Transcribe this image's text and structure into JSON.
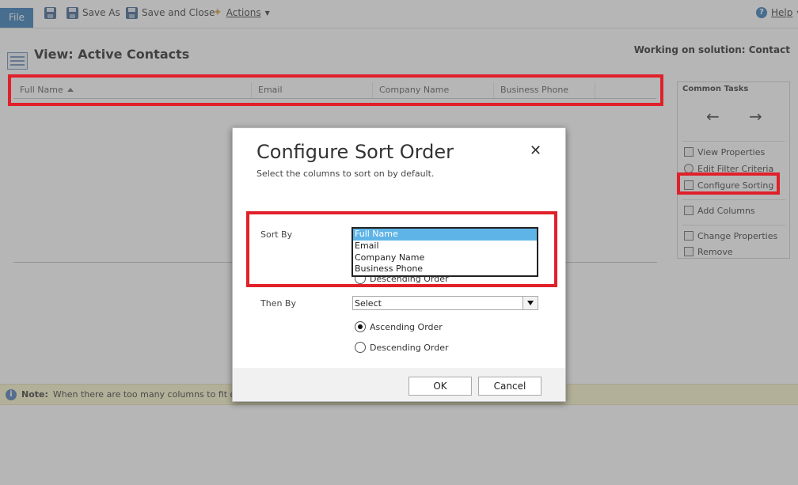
{
  "ribbon": {
    "file": "File",
    "save_as": "Save As",
    "save_close": "Save and Close",
    "actions": "Actions",
    "help": "Help"
  },
  "page": {
    "title": "View: Active Contacts",
    "solution": "Working on solution: Contact"
  },
  "grid": {
    "columns": [
      "Full Name",
      "Email",
      "Company Name",
      "Business Phone"
    ]
  },
  "common_tasks": {
    "title": "Common Tasks",
    "items": [
      "View Properties",
      "Edit Filter Criteria",
      "Configure Sorting",
      "Add Columns",
      "Change Properties",
      "Remove"
    ]
  },
  "note": {
    "label": "Note:",
    "text": "When there are too many columns to fit on a pa"
  },
  "dialog": {
    "title": "Configure Sort Order",
    "subtitle": "Select the columns to sort on by default.",
    "sort_by_label": "Sort By",
    "sort_by_options": [
      "Full Name",
      "Email",
      "Company Name",
      "Business Phone"
    ],
    "sort_by_selected": "Full Name",
    "sort_desc_label": "Descending Order",
    "then_by_label": "Then By",
    "then_by_value": "Select",
    "then_ascending_label": "Ascending Order",
    "then_descending_label": "Descending Order",
    "ok": "OK",
    "cancel": "Cancel"
  },
  "colors": {
    "highlight_red": "#e0202a",
    "file_blue": "#2f75b5",
    "selected_option": "#5eb4e6",
    "note_bg": "#f8f3c6"
  }
}
